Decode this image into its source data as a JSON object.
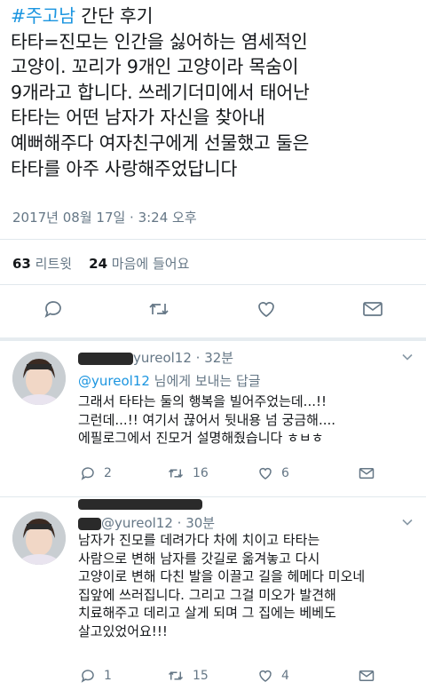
{
  "tweet": {
    "hashtag": "#주고남",
    "first_line_rest": " 간단 후기",
    "body": "타타=진모는 인간을 싫어하는 염세적인\n고양이. 꼬리가 9개인 고양이라 목숨이\n9개라고 합니다. 쓰레기더미에서 태어난\n타타는 어떤 남자가 자신을 찾아내\n예뻐해주다 여자친구에게 선물했고 둘은\n타타를 아주 사랑해주었답니다",
    "timestamp": "2017년 08월 17일 · 3:24 오후",
    "retweet_count": "63",
    "retweet_label": "리트윗",
    "like_count": "24",
    "like_label": "마음에 들어요"
  },
  "replies": [
    {
      "handle_partial": "yureol12",
      "time": "· 32분",
      "replying_prefix": "@",
      "replying_handle": "yureol12",
      "replying_suffix": " 님에게 보내는 답글",
      "text": "그래서 타타는 둘의 행복을 빌어주었는데...!!\n그런데...!! 여기서 끊어서 뒷내용 넘 궁금해....\n에필로그에서 진모거 설명해줬습니다 ㅎㅂㅎ",
      "reply_count": "2",
      "retweet_count": "16",
      "like_count": "6"
    },
    {
      "handle_partial": "@yureol12",
      "time": "· 30분",
      "text": "남자가 진모를 데려가다 차에 치이고 타타는\n사람으로 변해 남자를 갓길로 옮겨놓고 다시\n고양이로 변해 다친 발을 이끌고 길을 헤메다 미오네\n집앞에 쓰러집니다. 그리고 그걸 미오가 발견해\n치료해주고 데리고 살게 되며 그 집에는 베베도\n살고있었어요!!!",
      "reply_count": "1",
      "retweet_count": "15",
      "like_count": "4"
    }
  ],
  "icons": {
    "reply": "speech-bubble-icon",
    "retweet": "retweet-arrows-icon",
    "like": "heart-icon",
    "dm": "envelope-icon",
    "more": "chevron-down-icon"
  },
  "colors": {
    "link": "#1b95e0",
    "muted": "#657786",
    "divider": "#e1e8ed"
  }
}
